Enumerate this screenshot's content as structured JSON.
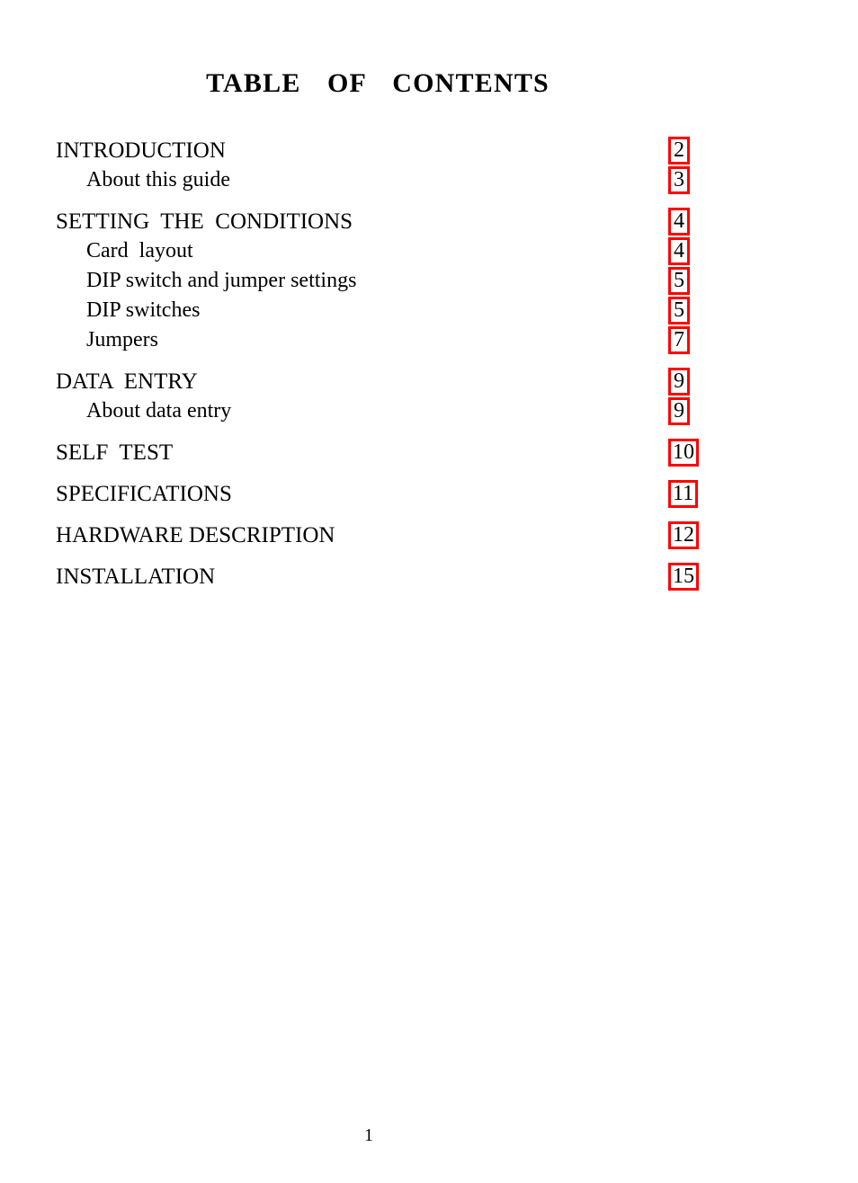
{
  "document": {
    "title": "TABLE  OF  CONTENTS",
    "footer_page_number": "1",
    "accent_color": "#ff0000",
    "text_color": "#000000",
    "background_color": "#ffffff"
  },
  "toc": {
    "groups": [
      {
        "entries": [
          {
            "label": "INTRODUCTION",
            "page": "2",
            "level": "main"
          },
          {
            "label": "About this guide",
            "page": "3",
            "level": "sub"
          }
        ]
      },
      {
        "entries": [
          {
            "label": "SETTING  THE  CONDITIONS",
            "page": "4",
            "level": "main"
          },
          {
            "label": "Card  layout",
            "page": "4",
            "level": "sub"
          },
          {
            "label": "DIP switch and jumper settings",
            "page": "5",
            "level": "sub"
          },
          {
            "label": "DIP switches",
            "page": "5",
            "level": "sub"
          },
          {
            "label": "Jumpers",
            "page": "7",
            "level": "sub"
          }
        ]
      },
      {
        "entries": [
          {
            "label": "DATA  ENTRY",
            "page": "9",
            "level": "main"
          },
          {
            "label": "About data entry",
            "page": "9",
            "level": "sub"
          }
        ]
      },
      {
        "entries": [
          {
            "label": "SELF  TEST",
            "page": "10",
            "level": "main"
          }
        ]
      },
      {
        "entries": [
          {
            "label": "SPECIFICATIONS",
            "page": "11",
            "level": "main"
          }
        ]
      },
      {
        "entries": [
          {
            "label": "HARDWARE DESCRIPTION",
            "page": "12",
            "level": "main"
          }
        ]
      },
      {
        "entries": [
          {
            "label": "INSTALLATION",
            "page": "15",
            "level": "main"
          }
        ]
      }
    ]
  }
}
